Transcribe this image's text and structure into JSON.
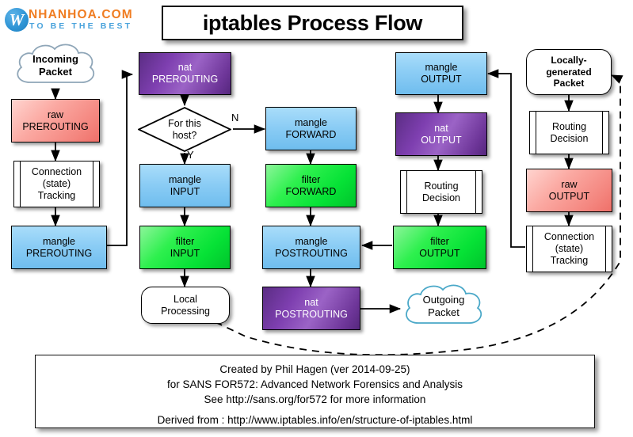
{
  "logo": {
    "mark_letter": "W",
    "name": "NHANHOA.COM",
    "tagline": "TO BE THE BEST",
    "name_color": "#f07d22",
    "tagline_color": "#4aa3dc",
    "mark_color": "#2f95d6"
  },
  "title": "iptables  Process Flow",
  "palette": {
    "raw": "#f4867f",
    "mangle": "#8ccdf5",
    "filter": "#2ef04e",
    "nat": "#7e3fb0",
    "process": "#ffffff",
    "cloud_incoming_stroke": "#8fa6b8",
    "cloud_outgoing_stroke": "#4aa8c8"
  },
  "nodes": {
    "incoming_packet": {
      "l1": "Incoming",
      "l2": "Packet",
      "shape": "cloud",
      "color": "white"
    },
    "raw_prerouting": {
      "l1": "raw",
      "l2": "PREROUTING",
      "shape": "box",
      "color": "red"
    },
    "conntrack_in": {
      "l1": "Connection",
      "l2": "(state)",
      "l3": "Tracking",
      "shape": "process",
      "color": "white"
    },
    "mangle_prerouting": {
      "l1": "mangle",
      "l2": "PREROUTING",
      "shape": "box",
      "color": "blue"
    },
    "nat_prerouting": {
      "l1": "nat",
      "l2": "PREROUTING",
      "shape": "box",
      "color": "purple"
    },
    "decision_host": {
      "l1": "For this",
      "l2": "host?",
      "shape": "diamond",
      "color": "white"
    },
    "mangle_input": {
      "l1": "mangle",
      "l2": "INPUT",
      "shape": "box",
      "color": "blue"
    },
    "filter_input": {
      "l1": "filter",
      "l2": "INPUT",
      "shape": "box",
      "color": "green"
    },
    "local_processing": {
      "l1": "Local",
      "l2": "Processing",
      "shape": "terminator",
      "color": "white"
    },
    "mangle_forward": {
      "l1": "mangle",
      "l2": "FORWARD",
      "shape": "box",
      "color": "blue"
    },
    "filter_forward": {
      "l1": "filter",
      "l2": "FORWARD",
      "shape": "box",
      "color": "green"
    },
    "mangle_postrouting": {
      "l1": "mangle",
      "l2": "POSTROUTING",
      "shape": "box",
      "color": "blue"
    },
    "nat_postrouting": {
      "l1": "nat",
      "l2": "POSTROUTING",
      "shape": "box",
      "color": "purple"
    },
    "mangle_output": {
      "l1": "mangle",
      "l2": "OUTPUT",
      "shape": "box",
      "color": "blue"
    },
    "nat_output": {
      "l1": "nat",
      "l2": "OUTPUT",
      "shape": "box",
      "color": "purple"
    },
    "routing_decision_mid": {
      "l1": "Routing",
      "l2": "Decision",
      "shape": "process",
      "color": "white"
    },
    "filter_output": {
      "l1": "filter",
      "l2": "OUTPUT",
      "shape": "box",
      "color": "green"
    },
    "outgoing_packet": {
      "l1": "Outgoing",
      "l2": "Packet",
      "shape": "cloud",
      "color": "white"
    },
    "locally_generated": {
      "l1": "Locally-",
      "l2": "generated",
      "l3": "Packet",
      "shape": "terminator",
      "color": "white"
    },
    "routing_decision_right": {
      "l1": "Routing",
      "l2": "Decision",
      "shape": "process",
      "color": "white"
    },
    "raw_output": {
      "l1": "raw",
      "l2": "OUTPUT",
      "shape": "box",
      "color": "red"
    },
    "conntrack_out": {
      "l1": "Connection",
      "l2": "(state)",
      "l3": "Tracking",
      "shape": "process",
      "color": "white"
    }
  },
  "edge_labels": {
    "yes": "Y",
    "no": "N"
  },
  "footer": {
    "line1": "Created by Phil Hagen (ver 2014-09-25)",
    "line2": "for SANS FOR572: Advanced Network Forensics and Analysis",
    "line3": "See http://sans.org/for572 for more information",
    "line4": "Derived from : http://www.iptables.info/en/structure-of-iptables.html"
  }
}
